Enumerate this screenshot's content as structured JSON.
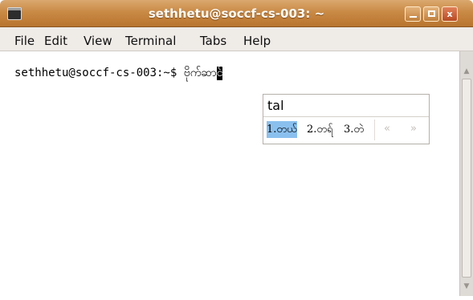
{
  "window": {
    "title": "sethhetu@soccf-cs-003: ~",
    "buttons": {
      "minimize": "",
      "maximize": "",
      "close": "x"
    }
  },
  "menubar": {
    "items": [
      "File",
      "Edit",
      "View",
      "Terminal",
      "Tabs",
      "Help"
    ]
  },
  "terminal": {
    "prompt": "sethhetu@soccf-cs-003:~$ ",
    "typed_text": "ဗိုက်ဆာ",
    "cursor_char": "င",
    "preedit_text": "်"
  },
  "ime": {
    "preedit": "tal",
    "candidates": [
      {
        "label": "1.တယ်",
        "selected": true
      },
      {
        "label": "2.တရ်",
        "selected": false
      },
      {
        "label": "3.တဲ",
        "selected": false
      }
    ],
    "prev_label": "«",
    "next_label": "»"
  },
  "scrollbar": {
    "up_label": "▲",
    "down_label": "▼"
  }
}
